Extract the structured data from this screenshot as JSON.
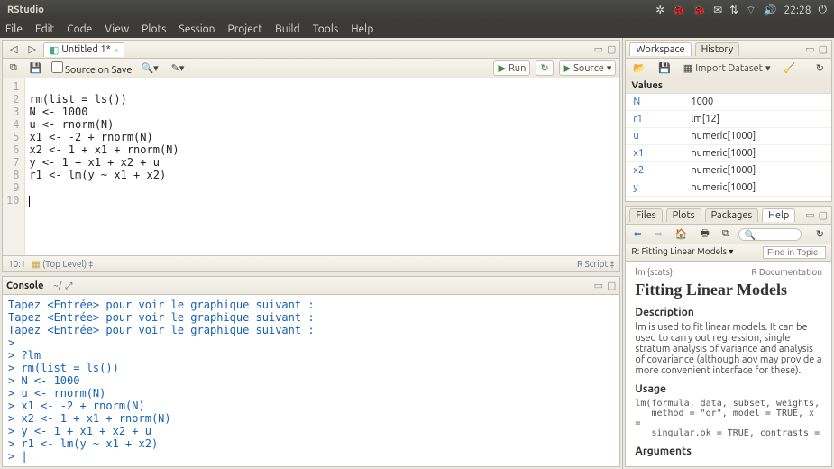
{
  "app_title": "RStudio",
  "menus": [
    "File",
    "Edit",
    "Code",
    "View",
    "Plots",
    "Session",
    "Project",
    "Build",
    "Tools",
    "Help"
  ],
  "sys_time": "22:28",
  "editor": {
    "tab_label": "Untitled 1*",
    "source_on_save": "Source on Save",
    "run": "Run",
    "source_btn": "Source",
    "lines": [
      "",
      "rm(list = ls())",
      "N <- 1000",
      "u <- rnorm(N)",
      "x1 <- -2 + rnorm(N)",
      "x2 <- 1 + x1 + rnorm(N)",
      "y <- 1 + x1 + x2 + u",
      "r1 <- lm(y ~ x1 + x2)",
      "",
      ""
    ],
    "status_left": "10:1",
    "status_scope": "(Top Level) ‡",
    "status_right": "R Script ‡"
  },
  "console": {
    "title": "Console",
    "path": "~/ ",
    "lines": [
      {
        "t": "msg",
        "v": "Tapez <Entrée> pour voir le graphique suivant :"
      },
      {
        "t": "msg",
        "v": "Tapez <Entrée> pour voir le graphique suivant :"
      },
      {
        "t": "msg",
        "v": "Tapez <Entrée> pour voir le graphique suivant :"
      },
      {
        "t": "prm",
        "v": ">"
      },
      {
        "t": "inp",
        "v": "> ?lm"
      },
      {
        "t": "inp",
        "v": "> rm(list = ls())"
      },
      {
        "t": "inp",
        "v": "> N <- 1000"
      },
      {
        "t": "inp",
        "v": "> u <- rnorm(N)"
      },
      {
        "t": "inp",
        "v": "> x1 <- -2 + rnorm(N)"
      },
      {
        "t": "inp",
        "v": "> x2 <- 1 + x1 + rnorm(N)"
      },
      {
        "t": "inp",
        "v": "> y <- 1 + x1 + x2 + u"
      },
      {
        "t": "inp",
        "v": "> r1 <- lm(y ~ x1 + x2)"
      },
      {
        "t": "prm",
        "v": "> |"
      }
    ]
  },
  "workspace": {
    "tabs": [
      "Workspace",
      "History"
    ],
    "import": "Import Dataset",
    "section": "Values",
    "rows": [
      {
        "n": "N",
        "v": "1000"
      },
      {
        "n": "r1",
        "v": "lm[12]"
      },
      {
        "n": "u",
        "v": "numeric[1000]"
      },
      {
        "n": "x1",
        "v": "numeric[1000]"
      },
      {
        "n": "x2",
        "v": "numeric[1000]"
      },
      {
        "n": "y",
        "v": "numeric[1000]"
      }
    ]
  },
  "help": {
    "tabs": [
      "Files",
      "Plots",
      "Packages",
      "Help"
    ],
    "breadcrumb": "R: Fitting Linear Models",
    "find_placeholder": "Find in Topic",
    "pkg": "lm {stats}",
    "doclabel": "R Documentation",
    "title": "Fitting Linear Models",
    "h_desc": "Description",
    "desc": "lm is used to fit linear models. It can be used to carry out regression, single stratum analysis of variance and analysis of covariance (although aov may provide a more convenient interface for these).",
    "h_usage": "Usage",
    "usage": "lm(formula, data, subset, weights,\n   method = \"qr\", model = TRUE, x =\n   singular.ok = TRUE, contrasts =",
    "h_args": "Arguments"
  }
}
